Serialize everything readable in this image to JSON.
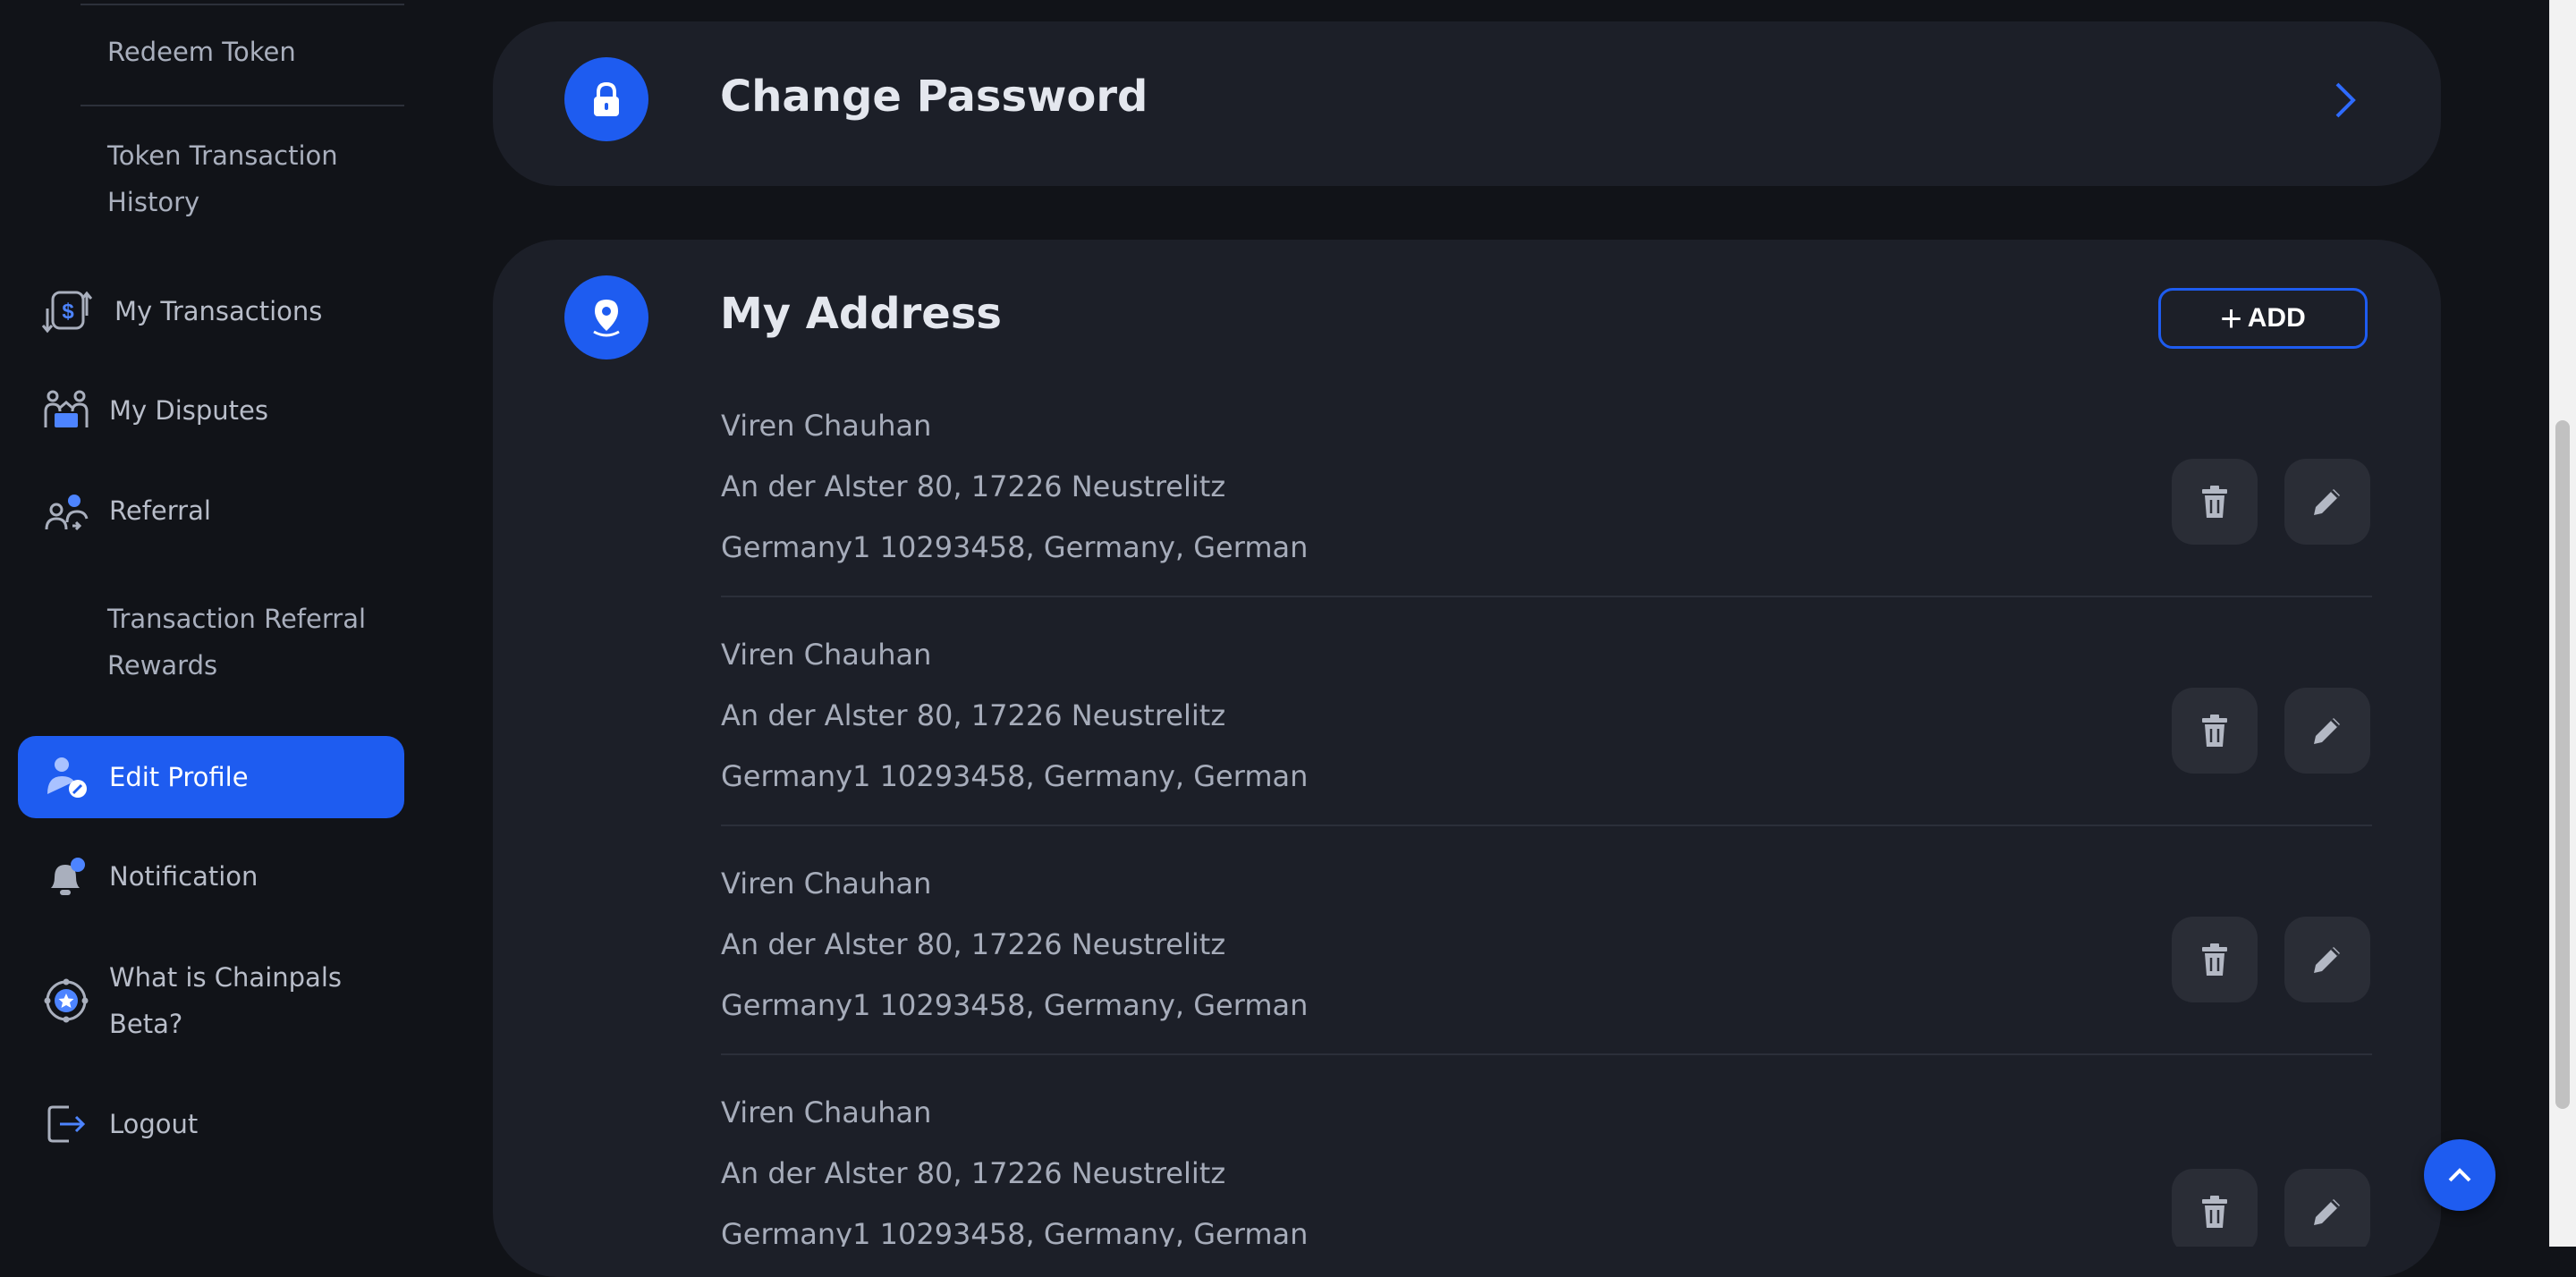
{
  "sidebar": {
    "sub_items": {
      "redeem_token": "Redeem Token",
      "token_history_line1": "Token Transaction",
      "token_history_line2": "History",
      "referral_rewards_line1": "Transaction Referral",
      "referral_rewards_line2": "Rewards"
    },
    "items": {
      "my_transactions": "My Transactions",
      "my_disputes": "My Disputes",
      "referral": "Referral",
      "edit_profile": "Edit Profile",
      "notification": "Notification",
      "chainpals_line1": "What is Chainpals",
      "chainpals_line2": "Beta?",
      "logout": "Logout"
    },
    "active_item": "Edit Profile"
  },
  "change_password": {
    "title": "Change Password"
  },
  "address": {
    "title": "My Address",
    "add_label": "ADD",
    "entries": [
      {
        "name": "Viren Chauhan",
        "street": "An der Alster 80, 17226 Neustrelitz",
        "region": "Germany1 10293458, Germany, German"
      },
      {
        "name": "Viren Chauhan",
        "street": "An der Alster 80, 17226 Neustrelitz",
        "region": "Germany1 10293458, Germany, German"
      },
      {
        "name": "Viren Chauhan",
        "street": "An der Alster 80, 17226 Neustrelitz",
        "region": "Germany1 10293458, Germany, German"
      },
      {
        "name": "Viren Chauhan",
        "street": "An der Alster 80, 17226 Neustrelitz",
        "region": "Germany1 10293458, Germany, German"
      }
    ]
  },
  "colors": {
    "accent": "#1e5cf0",
    "page_bg": "#111318",
    "card_bg": "#1c1f28",
    "icon_button_bg": "#2a2d36",
    "muted_text": "#a6acba"
  },
  "icons": {
    "change_password": "lock-icon",
    "address": "location-pin-icon",
    "delete": "trash-icon",
    "edit": "pencil-icon",
    "scroll_top": "chevron-up-icon"
  }
}
